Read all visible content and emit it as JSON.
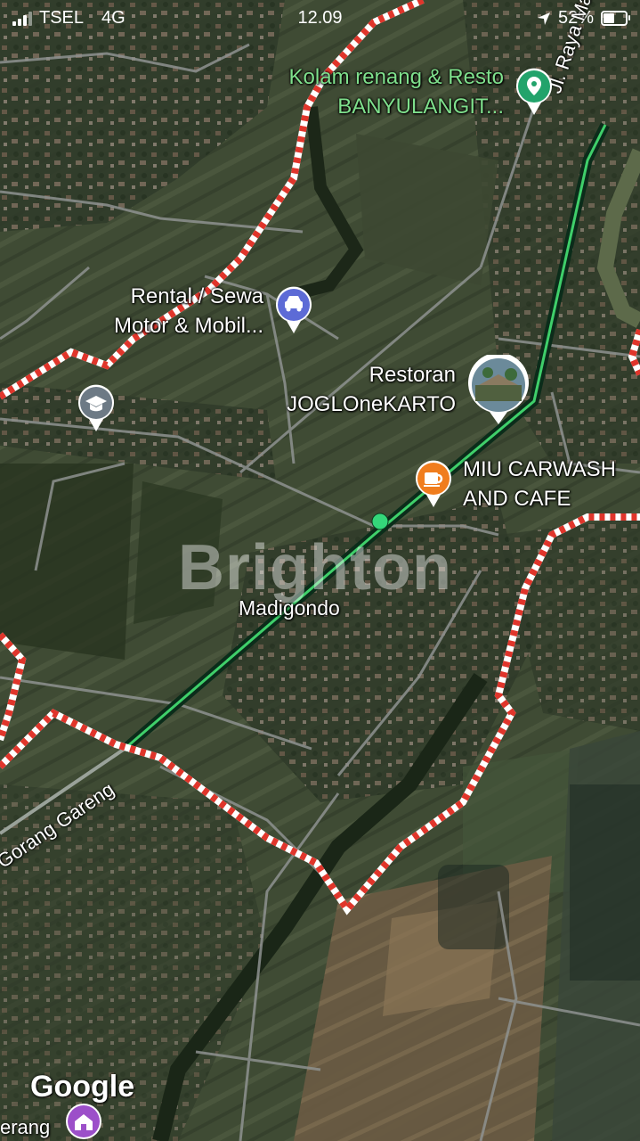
{
  "status_bar": {
    "carrier": "TSEL",
    "network": "4G",
    "time": "12.09",
    "battery": "52%",
    "battery_level": 0.52
  },
  "map": {
    "watermark": "Brighton",
    "attribution": "Google",
    "area_label": "Madigondo",
    "roads": {
      "road_1": "Jl. Raya Madigon",
      "road_2": "Gorang Gareng",
      "road_3": "erang"
    },
    "places": [
      {
        "name_line1": "Kolam renang & Resto",
        "name_line2": "BANYULANGIT...",
        "icon": "map-pin-icon",
        "color": "#22a36b"
      },
      {
        "name_line1": "Rental / Sewa",
        "name_line2": "Motor & Mobil...",
        "icon": "car-icon",
        "color": "#5d6bd6"
      },
      {
        "name_line1": "Restoran",
        "name_line2": "JOGLOneKARTO",
        "icon": "photo-thumbnail",
        "color": "#ffffff"
      },
      {
        "name_line1": "MIU CARWASH",
        "name_line2": "AND CAFE",
        "icon": "coffee-cup-icon",
        "color": "#f07d1e"
      },
      {
        "icon": "school-cap-icon",
        "color": "#6d7a85"
      },
      {
        "icon": "place-of-worship-icon",
        "color": "#9c4fc9"
      }
    ],
    "colors": {
      "boundary_red": "#e0352b",
      "route_green": "#3fcf6a"
    }
  }
}
